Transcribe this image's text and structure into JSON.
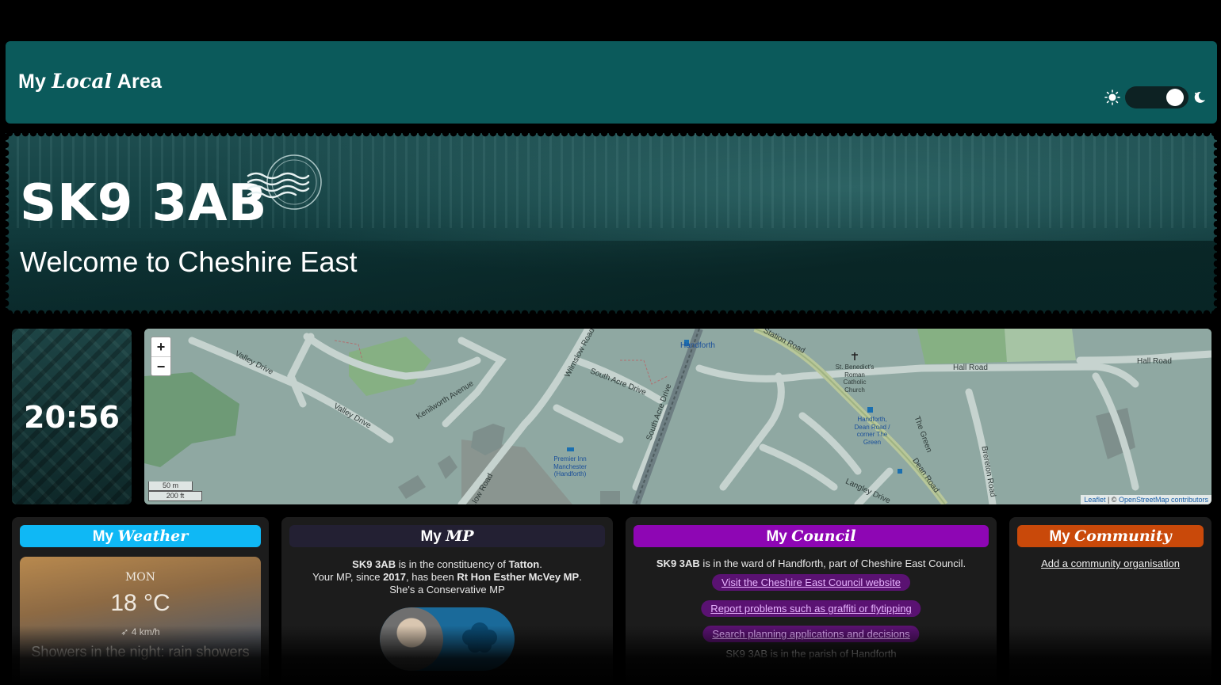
{
  "header": {
    "brand_my": "My",
    "brand_local": "Local",
    "brand_area": "Area",
    "theme_toggle": "dark"
  },
  "hero": {
    "postcode": "SK9 3AB",
    "welcome": "Welcome to Cheshire East"
  },
  "clock": {
    "time": "20:56"
  },
  "map": {
    "zoom_in": "+",
    "zoom_out": "−",
    "scale_metric": "50 m",
    "scale_imperial": "200 ft",
    "attribution_leaflet": "Leaflet",
    "attribution_sep": " | © ",
    "attribution_osm": "OpenStreetMap contributors",
    "labels": {
      "valley_drive_1": "Valley Drive",
      "valley_drive_2": "Valley Drive",
      "kenilworth": "Kenilworth Avenue",
      "wilmslow": "Wilmslow Road",
      "south_acre_1": "South Acre Drive",
      "south_acre_2": "South Acre Drive",
      "handforth": "Handforth",
      "station_road": "Station Road",
      "hall_road_1": "Hall Road",
      "hall_road_2": "Hall Road",
      "st_benedicts": "St. Benedict's Roman Catholic Church",
      "bus_stop": "Handforth, Dean Road / corner The Green",
      "the_green": "The Green",
      "dean_road": "Dean Road",
      "brereton": "Brereton Road",
      "langley": "Langley Drive",
      "premier_inn": "Premier Inn Manchester (Handforth)",
      "low_road": "...low Road"
    }
  },
  "weather": {
    "title_my": "My",
    "title_em": "Weather",
    "day": "MON",
    "temp": "18 °C",
    "wind": "4 km/h",
    "desc": "Showers in the night: rain showers"
  },
  "mp": {
    "title_my": "My",
    "title_em": "MP",
    "line1_postcode": "SK9 3AB",
    "line1_mid": " is in the constituency of ",
    "line1_const": "Tatton",
    "line1_end": ".",
    "line2_a": "Your MP, since ",
    "line2_year": "2017",
    "line2_b": ", has been ",
    "line2_name": "Rt Hon Esther McVey MP",
    "line2_end": ".",
    "line3": "She's a Conservative MP"
  },
  "council": {
    "title_my": "My",
    "title_em": "Council",
    "line_postcode": "SK9 3AB",
    "line_rest": " is in the ward of Handforth, part of Cheshire East Council.",
    "link_website": "Visit the Cheshire East Council website",
    "link_report": "Report problems such as graffiti or flytipping",
    "link_planning": "Search planning applications and decisions",
    "link_more": "SK9 3AB is in the parish of Handforth"
  },
  "community": {
    "title_my": "My",
    "title_em": "Community",
    "add_link": "Add a community organisation"
  }
}
